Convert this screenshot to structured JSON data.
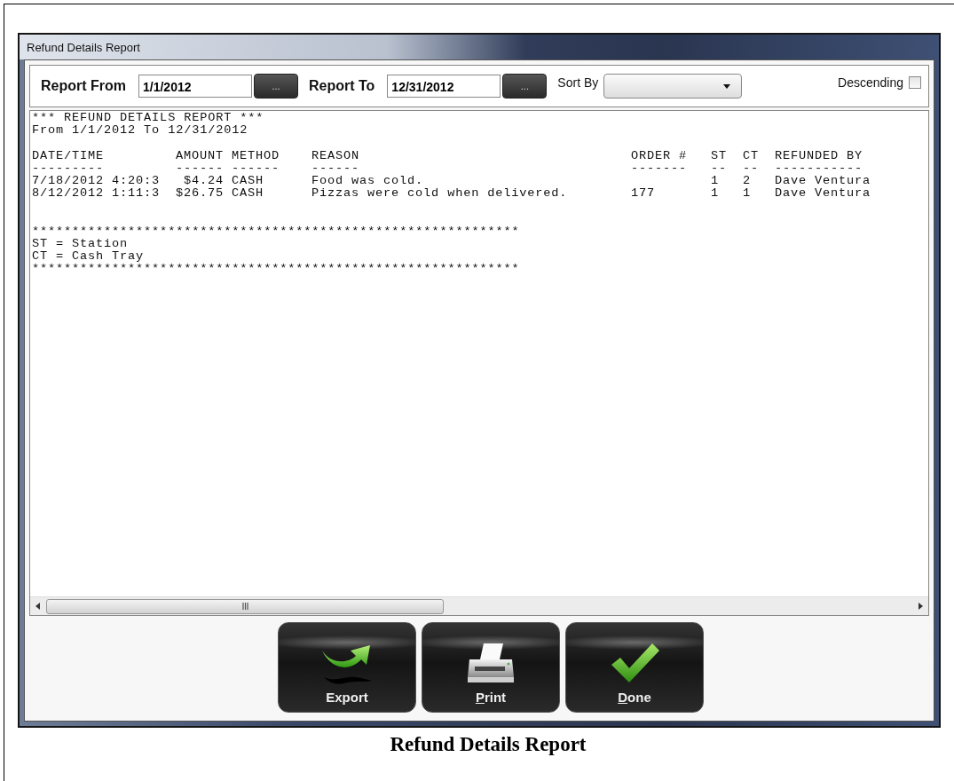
{
  "window": {
    "title": "Refund Details Report"
  },
  "filters": {
    "from_label": "Report From",
    "from_value": "1/1/2012",
    "from_picker": "...",
    "to_label": "Report To",
    "to_value": "12/31/2012",
    "to_picker": "...",
    "sort_label": "Sort By",
    "descending_label": "Descending",
    "descending_checked": false
  },
  "report": {
    "heading_lines": [
      "*** REFUND DETAILS REPORT ***",
      "From 1/1/2012 To 12/31/2012"
    ],
    "columns": [
      {
        "label": "DATE/TIME",
        "underline": "---------"
      },
      {
        "label": "AMOUNT",
        "underline": "------"
      },
      {
        "label": "METHOD",
        "underline": "------"
      },
      {
        "label": "REASON",
        "underline": "------"
      },
      {
        "label": "ORDER #",
        "underline": "-------"
      },
      {
        "label": "ST",
        "underline": "--"
      },
      {
        "label": "CT",
        "underline": "--"
      },
      {
        "label": "REFUNDED BY",
        "underline": "-----------"
      }
    ],
    "rows": [
      {
        "date_time": "7/18/2012 4:20:3",
        "amount": "$4.24",
        "method": "CASH",
        "reason": "Food was cold.",
        "st": "1",
        "ct": "2",
        "refunded_by": "Dave Ventura"
      },
      {
        "date_time": "8/12/2012 1:11:3",
        "amount": "$26.75",
        "method": "CASH",
        "reason": "Pizzas were cold when delivered.",
        "order": "177",
        "st": "1",
        "ct": "1",
        "refunded_by": "Dave Ventura"
      }
    ],
    "separator_top": "*************************************************************",
    "legend": [
      "ST = Station",
      "CT = Cash Tray"
    ],
    "separator_bottom": "*************************************************************"
  },
  "buttons": [
    {
      "label": "Export",
      "kind": "export",
      "access_key_underlined": false
    },
    {
      "label": "Print",
      "kind": "print",
      "access_key_underlined": true
    },
    {
      "label": "Done",
      "kind": "done",
      "access_key_underlined": true
    }
  ],
  "caption": "Refund Details Report"
}
